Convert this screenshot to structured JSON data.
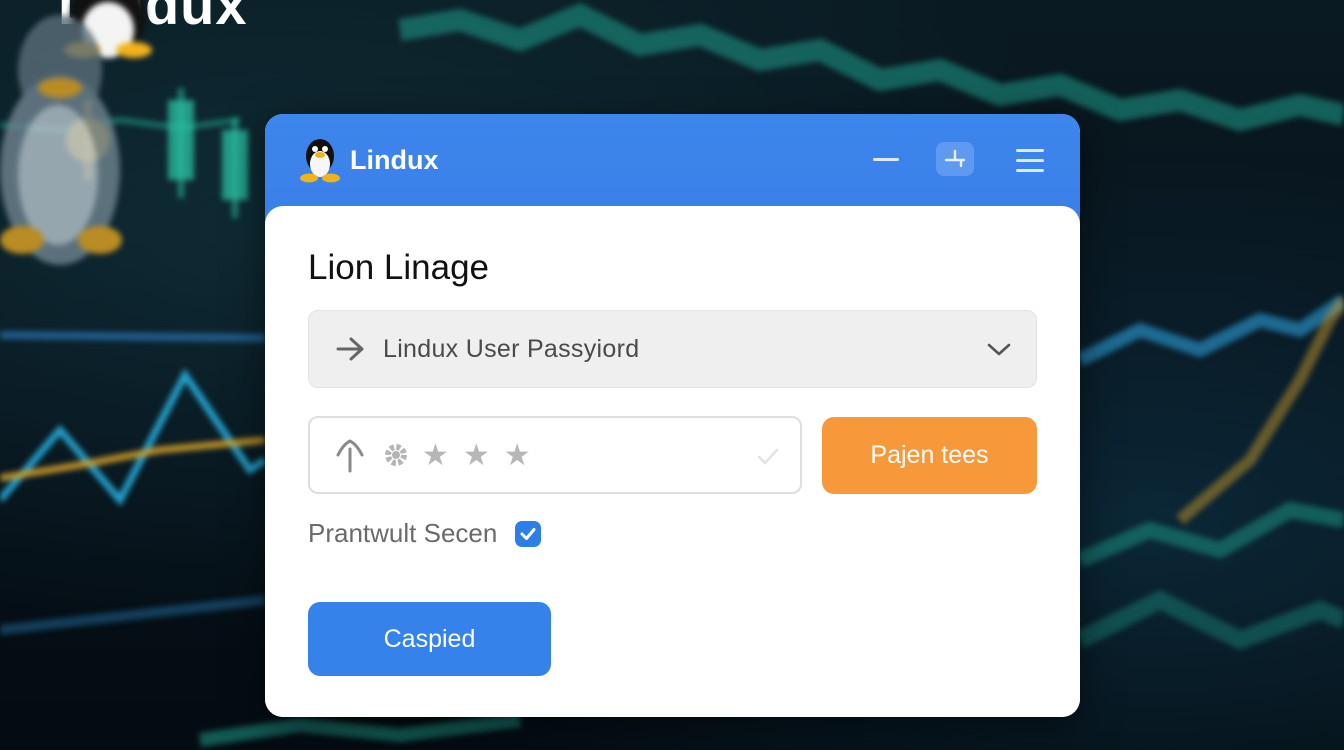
{
  "background": {
    "logo_text": "Lindux"
  },
  "window": {
    "brand_name": "Lindux",
    "heading": "Lion Linage",
    "account_select": {
      "value": "Lindux User  Passyiord"
    },
    "password_field": {
      "masked_value": "★★★"
    },
    "primary_action_label": "Pajen tees",
    "remember": {
      "label": "Prantwult Secen",
      "checked": true
    },
    "submit_label": "Caspied"
  },
  "colors": {
    "titlebar": "#3a7fe8",
    "orange_button": "#f7993a",
    "blue_button": "#3583ea",
    "checkbox": "#2e7ee6"
  }
}
